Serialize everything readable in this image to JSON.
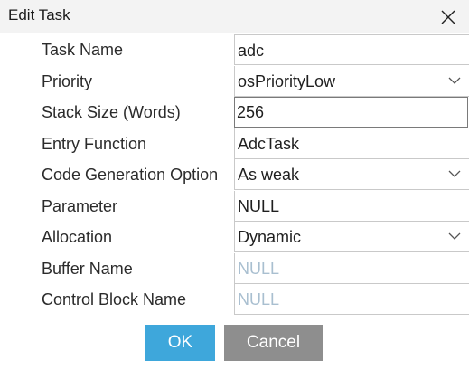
{
  "dialog": {
    "title": "Edit Task"
  },
  "fields": [
    {
      "label": "Task Name",
      "value": "adc",
      "type": "text"
    },
    {
      "label": "Priority",
      "value": "osPriorityLow",
      "type": "select"
    },
    {
      "label": "Stack Size (Words)",
      "value": "256",
      "type": "number"
    },
    {
      "label": "Entry Function",
      "value": "AdcTask",
      "type": "text"
    },
    {
      "label": "Code Generation Option",
      "value": "As weak",
      "type": "select"
    },
    {
      "label": "Parameter",
      "value": "NULL",
      "type": "text"
    },
    {
      "label": "Allocation",
      "value": "Dynamic",
      "type": "select"
    },
    {
      "label": "Buffer Name",
      "value": "NULL",
      "type": "disabled"
    },
    {
      "label": "Control Block Name",
      "value": "NULL",
      "type": "disabled"
    }
  ],
  "buttons": {
    "ok": "OK",
    "cancel": "Cancel"
  },
  "colors": {
    "ok_button": "#3ea7db",
    "cancel_button": "#8e8e8e",
    "disabled_text": "#a9bfd0",
    "titlebar": "#f3f3f3"
  },
  "icons": {
    "close": "close-icon",
    "dropdown": "chevron-down-icon"
  }
}
